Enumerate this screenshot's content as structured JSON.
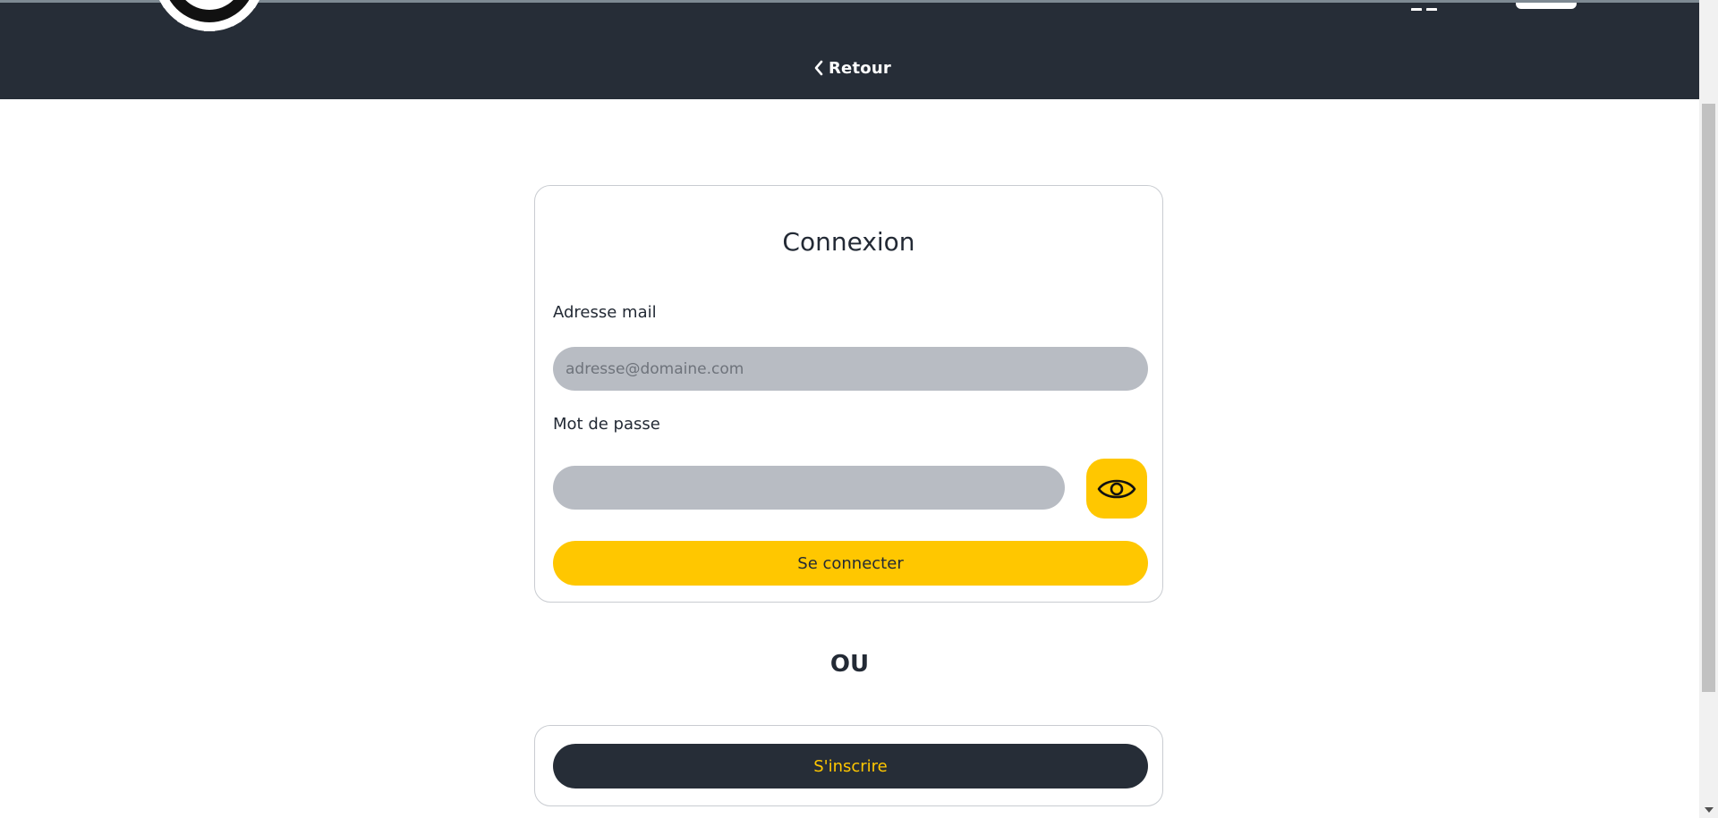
{
  "header": {
    "back_label": "Retour"
  },
  "login": {
    "title": "Connexion",
    "email_label": "Adresse mail",
    "email_placeholder": "adresse@domaine.com",
    "email_value": "",
    "password_label": "Mot de passe",
    "password_value": "",
    "submit_label": "Se connecter"
  },
  "separator": "OU",
  "signup": {
    "button_label": "S'inscrire"
  },
  "icons": {
    "back": "chevron-left-icon",
    "toggle_password": "eye-icon",
    "logo": "gear-logo-icon",
    "scroll_down": "arrow-down-icon"
  },
  "colors": {
    "header_bg": "#262d37",
    "accent": "#ffc700",
    "input_bg": "#b8bcc3",
    "text": "#232a35"
  }
}
